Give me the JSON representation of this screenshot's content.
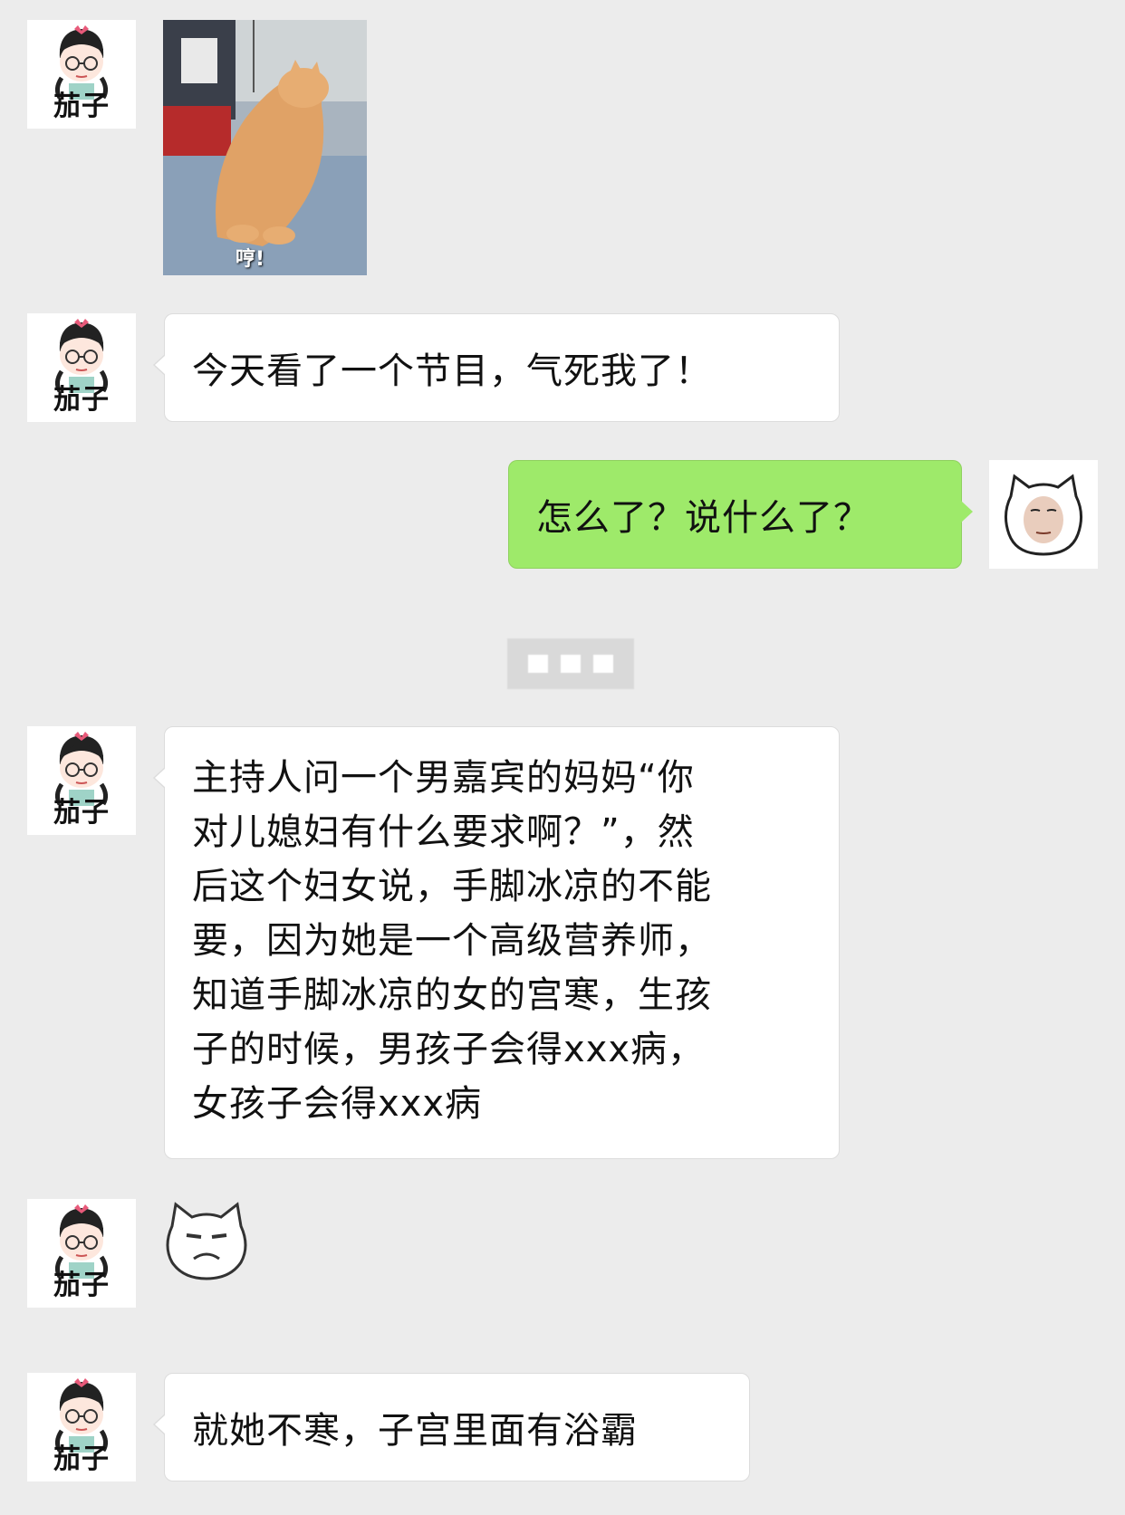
{
  "contact": {
    "name": "茄子"
  },
  "messages": [
    {
      "type": "image",
      "from": "contact",
      "caption": "哼!"
    },
    {
      "type": "text",
      "from": "contact",
      "text": "今天看了一个节目，气死我了！"
    },
    {
      "type": "text",
      "from": "me",
      "text": "怎么了？说什么了？"
    },
    {
      "type": "divider"
    },
    {
      "type": "text",
      "from": "contact",
      "text": "主持人问一个男嘉宾的妈妈“你\n对儿媳妇有什么要求啊？”，然\n后这个妇女说，手脚冰凉的不能\n要，因为她是一个高级营养师，\n知道手脚冰凉的女的宫寒，生孩\n子的时候，男孩子会得xxx病，\n女孩子会得xxx病"
    },
    {
      "type": "sticker",
      "from": "contact",
      "icon": "grumpy-cat-face-icon"
    },
    {
      "type": "text",
      "from": "contact",
      "text": "就她不寒，子宫里面有浴霸"
    }
  ],
  "colors": {
    "background": "#ececec",
    "incoming": "#ffffff",
    "outgoing": "#9eea6a"
  }
}
